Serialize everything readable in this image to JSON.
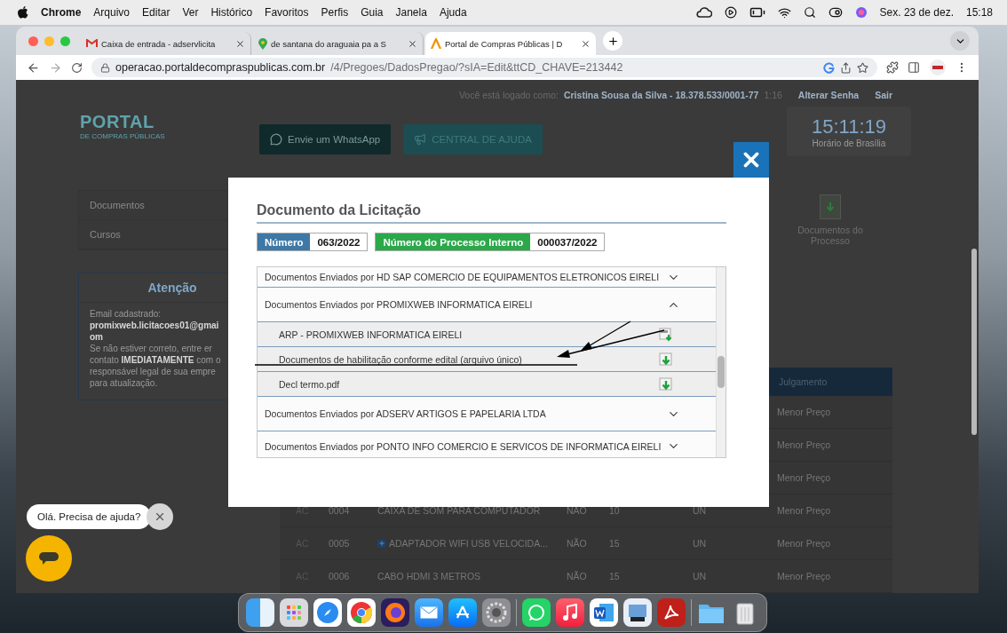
{
  "menu_bar": {
    "app": "Chrome",
    "items": [
      "Arquivo",
      "Editar",
      "Ver",
      "Histórico",
      "Favoritos",
      "Perfis",
      "Guia",
      "Janela",
      "Ajuda"
    ],
    "date": "Sex. 23 de dez.",
    "time": "15:18"
  },
  "browser": {
    "tabs": [
      {
        "title": "Caixa de entrada - adservlicita",
        "kind": "mail",
        "selected": false
      },
      {
        "title": "de santana do araguaia pa a S",
        "kind": "maps",
        "selected": false
      },
      {
        "title": "Portal de Compras Públicas | D",
        "kind": "portal",
        "selected": true
      }
    ],
    "url_host": "operacao.portaldecompraspublicas.com.br",
    "url_path": "/4/Pregoes/DadosPregao/?sIA=Edit&ttCD_CHAVE=213442"
  },
  "page": {
    "session": {
      "label": "Você está logado como:",
      "user": "Cristina Sousa da Silva - 18.378.533/0001-77",
      "timer": "1:16",
      "links": [
        "Alterar Senha",
        "Sair"
      ]
    },
    "logo": {
      "title": "PORTAL",
      "subtitle": "DE COMPRAS PÚBLICAS"
    },
    "header_buttons": [
      {
        "label": "Envie um WhatsApp",
        "kind": "whatsapp"
      },
      {
        "label": "CENTRAL DE AJUDA",
        "kind": "help"
      }
    ],
    "clock": {
      "time": "15:11:19",
      "label": "Horário de Brasília"
    },
    "sidebar": [
      "Documentos",
      "Cursos"
    ],
    "notice": {
      "title": "Atenção",
      "lines": [
        "Email cadastrado:",
        "**promixweb.licitacoes01@gmai**",
        "**om**",
        "Se não estiver correto, entre er",
        "contato **IMEDIATAMENTE** com o",
        "responsável legal de sua empre",
        "para atualização."
      ]
    },
    "process_docs": "Documentos do Processo",
    "table": {
      "columns": [
        "Julgamento"
      ],
      "rows": [
        {
          "judgment": "Menor Preço"
        },
        {
          "judgment": "Menor Preço"
        },
        {
          "judgment": "Menor Preço"
        },
        {
          "status": "AC",
          "number": "0004",
          "description": "CAIXA DE SOM PARA COMPUTADOR",
          "flag": "NÃO",
          "quantity": "10",
          "unit": "UN",
          "judgment": "Menor Preço",
          "expandable": false
        },
        {
          "status": "AC",
          "number": "0005",
          "description": "ADAPTADOR WIFI USB VELOCIDA...",
          "flag": "NÃO",
          "quantity": "15",
          "unit": "UN",
          "judgment": "Menor Preço",
          "expandable": true
        },
        {
          "status": "AC",
          "number": "0006",
          "description": "CABO HDMI 3 METROS",
          "flag": "NÃO",
          "quantity": "15",
          "unit": "UN",
          "judgment": "Menor Preço",
          "expandable": false
        }
      ]
    }
  },
  "modal": {
    "title": "Documento da Licitação",
    "badges": [
      {
        "label": "Número",
        "value": "063/2022",
        "color": "#3d78a6"
      },
      {
        "label": "Número do Processo Interno",
        "value": "000037/2022",
        "color": "#2ba84a"
      }
    ],
    "groups": [
      {
        "title": "Documentos Enviados por HD SAP COMERCIO DE EQUIPAMENTOS ELETRONICOS EIRELI",
        "expanded": false
      },
      {
        "title": "Documentos Enviados por PROMIXWEB INFORMATICA EIRELI",
        "expanded": true,
        "files": [
          {
            "name": "ARP - PROMIXWEB INFORMATICA EIRELI",
            "kind": "pdf"
          },
          {
            "name": "Documentos de habilitação conforme edital (arquivo único)",
            "kind": "download"
          },
          {
            "name": "Decl termo.pdf",
            "kind": "download"
          }
        ]
      },
      {
        "title": "Documentos Enviados por ADSERV ARTIGOS E PAPELARIA LTDA",
        "expanded": false
      },
      {
        "title": "Documentos Enviados por PONTO INFO COMERCIO E SERVICOS DE INFORMATICA EIRELI",
        "expanded": false
      }
    ]
  },
  "chat": {
    "message": "Olá. Precisa de ajuda?"
  }
}
